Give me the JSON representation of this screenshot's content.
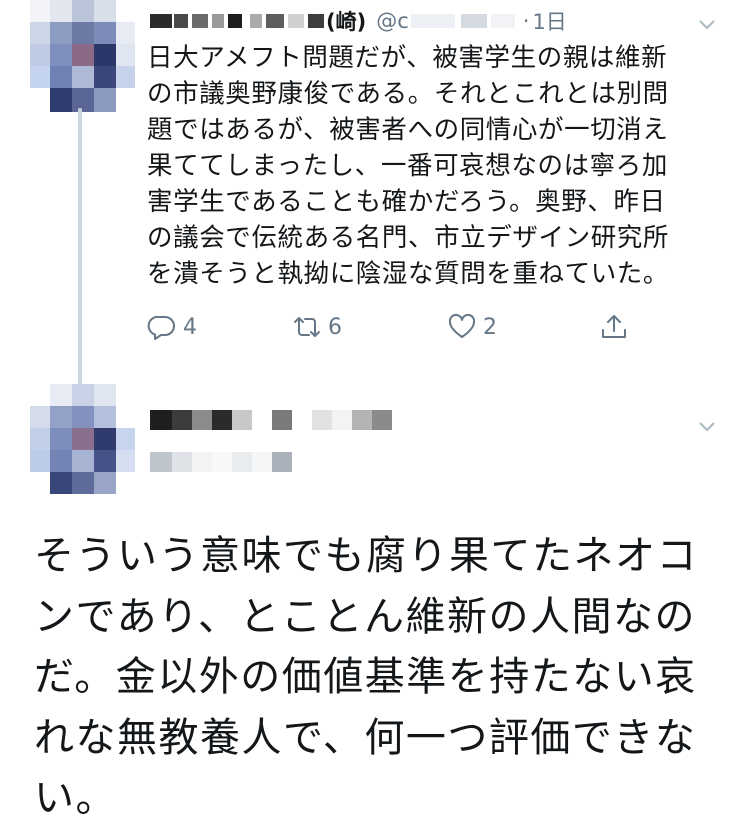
{
  "tweet": {
    "name_visible_fragment": "(崎)",
    "handle_prefix": "@c",
    "separator": "·",
    "timestamp": "1日",
    "body_lines": [
      "日大アメフト問題だが、被害学生の親は維新",
      "の市議奥野康俊である。それとこれとは別問",
      "題ではあるが、被害者への同情心が一切消え",
      "果ててしまったし、一番可哀想なのは寧ろ加",
      "害学生であることも確かだろう。奥野、昨日",
      "の議会で伝統ある名門、市立デザイン研究所",
      "を潰そうと執拗に陰湿な質問を重ねていた。"
    ],
    "actions": {
      "reply_count": "4",
      "retweet_count": "6",
      "like_count": "2"
    },
    "icons": [
      "reply-icon",
      "retweet-icon",
      "like-icon",
      "share-icon",
      "chevron-down-icon"
    ]
  },
  "reply": {
    "body_lines": [
      "そういう意味でも腐り果てたネオコ",
      "ンであり、とことん維新の人間なの",
      "だ。金以外の価値基準を持たない哀",
      "れな無教養人で、何一つ評価できな",
      "い。"
    ]
  },
  "colors": {
    "text": "#14171a",
    "muted": "#657786",
    "thread_line": "#ccd6dd",
    "avatar_blue": "#4a5a8c",
    "avatar_light": "#c4d3ef"
  }
}
